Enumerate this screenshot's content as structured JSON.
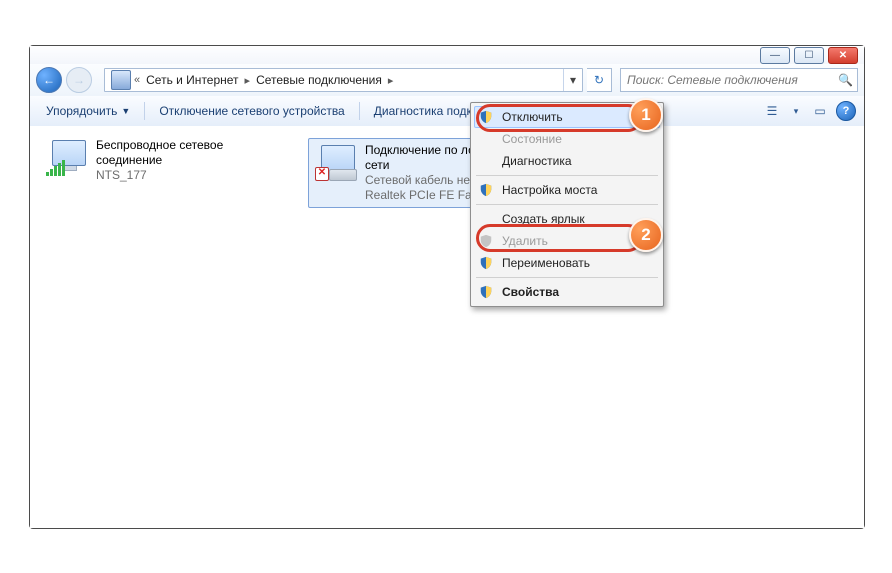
{
  "window": {
    "minimize_symbol": "—",
    "maximize_symbol": "☐",
    "close_symbol": "✕"
  },
  "breadcrumb": {
    "back_symbol": "←",
    "forward_symbol": "→",
    "chevron_prefix": "«",
    "seg1": "Сеть и Интернет",
    "seg2": "Сетевые подключения",
    "sep_arrow": "▸",
    "drop_symbol": "▾",
    "refresh_symbol": "↻"
  },
  "search": {
    "placeholder": "Поиск: Сетевые подключения",
    "icon": "🔍"
  },
  "toolbar": {
    "organize": "Упорядочить",
    "disable_device": "Отключение сетевого устройства",
    "diagnose": "Диагностика подключения",
    "more_symbol": "»",
    "view_symbol": "☰",
    "view_chev": "▾",
    "preview_symbol": "▭",
    "help_symbol": "?"
  },
  "connections": {
    "wifi": {
      "title_line1": "Беспроводное сетевое",
      "title_line2": "соединение",
      "ssid": "NTS_177"
    },
    "lan": {
      "title": "Подключение по локальной сети",
      "status": "Сетевой кабель не подключен",
      "device": "Realtek PCIe FE Family...",
      "x_badge": "✕"
    }
  },
  "context_menu": {
    "items": {
      "disable": {
        "label": "Отключить",
        "disabled": false,
        "bold": false,
        "has_shield": true,
        "shield_dim": false,
        "highlighted": true
      },
      "status": {
        "label": "Состояние",
        "disabled": true,
        "bold": false,
        "has_shield": false,
        "shield_dim": false,
        "highlighted": false
      },
      "diagnose": {
        "label": "Диагностика",
        "disabled": false,
        "bold": false,
        "has_shield": false,
        "shield_dim": false,
        "highlighted": false
      },
      "bridge": {
        "label": "Настройка моста",
        "disabled": false,
        "bold": false,
        "has_shield": true,
        "shield_dim": false,
        "highlighted": false
      },
      "shortcut": {
        "label": "Создать ярлык",
        "disabled": false,
        "bold": false,
        "has_shield": false,
        "shield_dim": false,
        "highlighted": false
      },
      "delete": {
        "label": "Удалить",
        "disabled": true,
        "bold": false,
        "has_shield": true,
        "shield_dim": true,
        "highlighted": false
      },
      "rename": {
        "label": "Переименовать",
        "disabled": false,
        "bold": false,
        "has_shield": true,
        "shield_dim": false,
        "highlighted": false
      },
      "properties": {
        "label": "Свойства",
        "disabled": false,
        "bold": true,
        "has_shield": true,
        "shield_dim": false,
        "highlighted": false
      }
    }
  },
  "callouts": {
    "1": "1",
    "2": "2"
  }
}
